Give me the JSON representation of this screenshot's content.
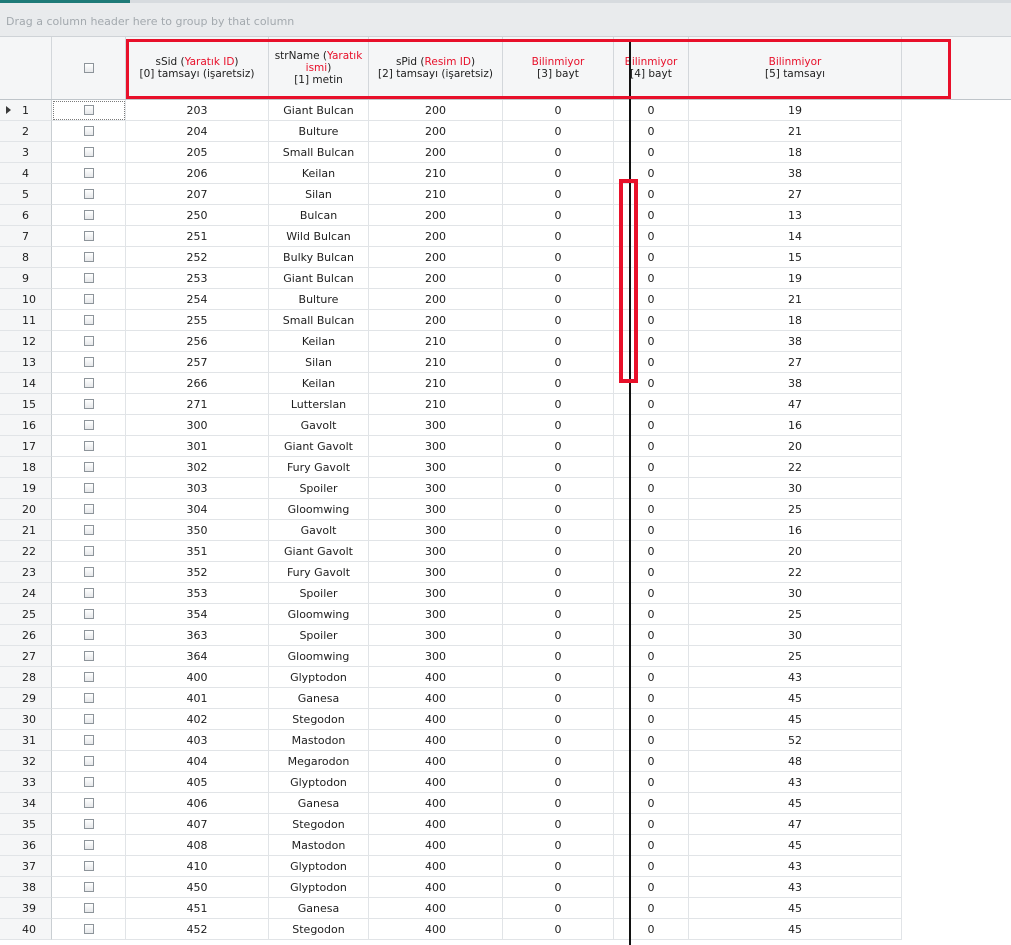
{
  "group_panel": {
    "hint": "Drag a column header here to group by that column"
  },
  "header": {
    "c0": {
      "pre": "sSid (",
      "red": "Yaratık ID",
      "post": ")",
      "line2": "[0] tamsayı (işaretsiz)"
    },
    "c1": {
      "pre": "strName (",
      "red": "Yaratık ismi",
      "post": ")",
      "line2": "[1] metin"
    },
    "c2": {
      "pre": "sPid (",
      "red": "Resim ID",
      "post": ")",
      "line2": "[2] tamsayı (işaretsiz)"
    },
    "c3": {
      "red": "Bilinmiyor",
      "line2": "[3] bayt"
    },
    "c4": {
      "red": "Bilinmiyor",
      "line2": "[4] bayt"
    },
    "c5": {
      "red": "Bilinmiyor",
      "line2": "[5] tamsayı"
    }
  },
  "colors": {
    "highlight": "#e8102a",
    "header_bg": "#f5f6f7",
    "accent": "#1e7a78"
  },
  "icons": {
    "row_indicator": "triangle-right-icon",
    "checkbox": "checkbox-unchecked-icon"
  },
  "rows": [
    [
      "1",
      "203",
      "Giant Bulcan",
      "200",
      "0",
      "0",
      "19"
    ],
    [
      "2",
      "204",
      "Bulture",
      "200",
      "0",
      "0",
      "21"
    ],
    [
      "3",
      "205",
      "Small Bulcan",
      "200",
      "0",
      "0",
      "18"
    ],
    [
      "4",
      "206",
      "Keilan",
      "210",
      "0",
      "0",
      "38"
    ],
    [
      "5",
      "207",
      "Silan",
      "210",
      "0",
      "0",
      "27"
    ],
    [
      "6",
      "250",
      "Bulcan",
      "200",
      "0",
      "0",
      "13"
    ],
    [
      "7",
      "251",
      "Wild Bulcan",
      "200",
      "0",
      "0",
      "14"
    ],
    [
      "8",
      "252",
      "Bulky Bulcan",
      "200",
      "0",
      "0",
      "15"
    ],
    [
      "9",
      "253",
      "Giant Bulcan",
      "200",
      "0",
      "0",
      "19"
    ],
    [
      "10",
      "254",
      "Bulture",
      "200",
      "0",
      "0",
      "21"
    ],
    [
      "11",
      "255",
      "Small Bulcan",
      "200",
      "0",
      "0",
      "18"
    ],
    [
      "12",
      "256",
      "Keilan",
      "210",
      "0",
      "0",
      "38"
    ],
    [
      "13",
      "257",
      "Silan",
      "210",
      "0",
      "0",
      "27"
    ],
    [
      "14",
      "266",
      "Keilan",
      "210",
      "0",
      "0",
      "38"
    ],
    [
      "15",
      "271",
      "Lutterslan",
      "210",
      "0",
      "0",
      "47"
    ],
    [
      "16",
      "300",
      "Gavolt",
      "300",
      "0",
      "0",
      "16"
    ],
    [
      "17",
      "301",
      "Giant Gavolt",
      "300",
      "0",
      "0",
      "20"
    ],
    [
      "18",
      "302",
      "Fury Gavolt",
      "300",
      "0",
      "0",
      "22"
    ],
    [
      "19",
      "303",
      "Spoiler",
      "300",
      "0",
      "0",
      "30"
    ],
    [
      "20",
      "304",
      "Gloomwing",
      "300",
      "0",
      "0",
      "25"
    ],
    [
      "21",
      "350",
      "Gavolt",
      "300",
      "0",
      "0",
      "16"
    ],
    [
      "22",
      "351",
      "Giant Gavolt",
      "300",
      "0",
      "0",
      "20"
    ],
    [
      "23",
      "352",
      "Fury Gavolt",
      "300",
      "0",
      "0",
      "22"
    ],
    [
      "24",
      "353",
      "Spoiler",
      "300",
      "0",
      "0",
      "30"
    ],
    [
      "25",
      "354",
      "Gloomwing",
      "300",
      "0",
      "0",
      "25"
    ],
    [
      "26",
      "363",
      "Spoiler",
      "300",
      "0",
      "0",
      "30"
    ],
    [
      "27",
      "364",
      "Gloomwing",
      "300",
      "0",
      "0",
      "25"
    ],
    [
      "28",
      "400",
      "Glyptodon",
      "400",
      "0",
      "0",
      "43"
    ],
    [
      "29",
      "401",
      "Ganesa",
      "400",
      "0",
      "0",
      "45"
    ],
    [
      "30",
      "402",
      "Stegodon",
      "400",
      "0",
      "0",
      "45"
    ],
    [
      "31",
      "403",
      "Mastodon",
      "400",
      "0",
      "0",
      "52"
    ],
    [
      "32",
      "404",
      "Megarodon",
      "400",
      "0",
      "0",
      "48"
    ],
    [
      "33",
      "405",
      "Glyptodon",
      "400",
      "0",
      "0",
      "43"
    ],
    [
      "34",
      "406",
      "Ganesa",
      "400",
      "0",
      "0",
      "45"
    ],
    [
      "35",
      "407",
      "Stegodon",
      "400",
      "0",
      "0",
      "47"
    ],
    [
      "36",
      "408",
      "Mastodon",
      "400",
      "0",
      "0",
      "45"
    ],
    [
      "37",
      "410",
      "Glyptodon",
      "400",
      "0",
      "0",
      "43"
    ],
    [
      "38",
      "450",
      "Glyptodon",
      "400",
      "0",
      "0",
      "43"
    ],
    [
      "39",
      "451",
      "Ganesa",
      "400",
      "0",
      "0",
      "45"
    ],
    [
      "40",
      "452",
      "Stegodon",
      "400",
      "0",
      "0",
      "45"
    ]
  ]
}
